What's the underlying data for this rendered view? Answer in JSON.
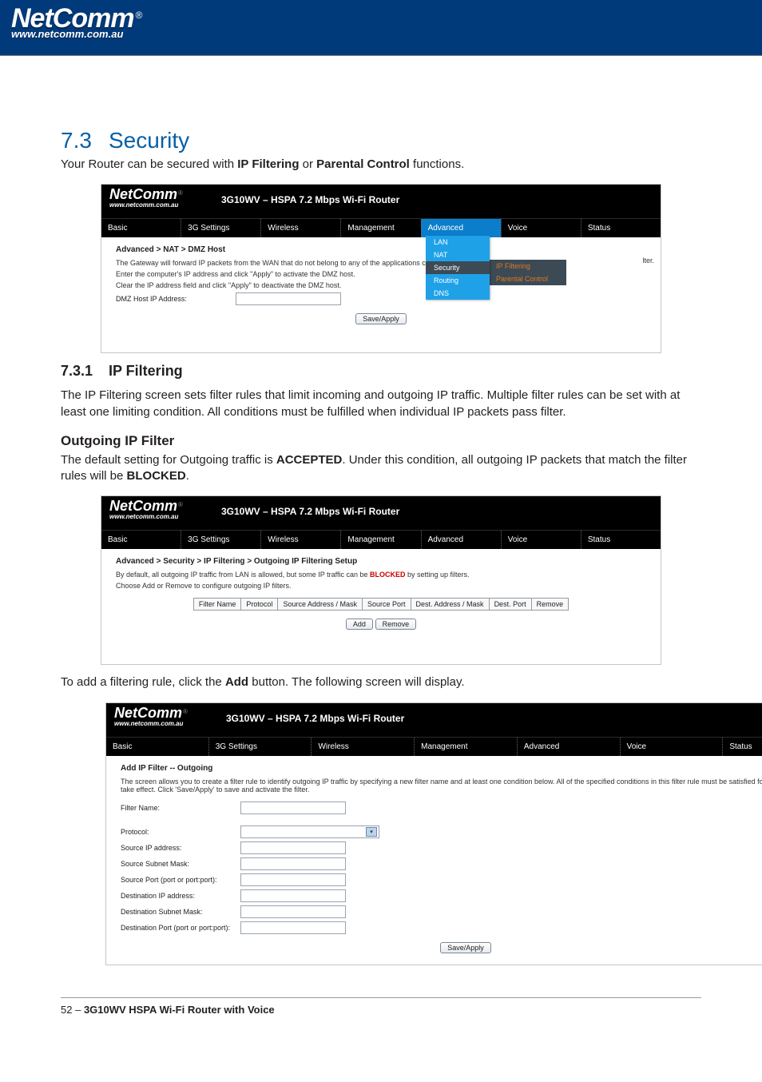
{
  "header": {
    "brand": "NetComm",
    "reg": "®",
    "url": "www.netcomm.com.au"
  },
  "section": {
    "number": "7.3",
    "title": "Security",
    "intro_plain_1": "Your Router can be secured with ",
    "intro_bold_1": "IP Filtering",
    "intro_plain_2": " or ",
    "intro_bold_2": "Parental Control",
    "intro_plain_3": " functions."
  },
  "shot1": {
    "brand": "NetComm",
    "reg": "®",
    "url": "www.netcomm.com.au",
    "title": "3G10WV – HSPA 7.2 Mbps Wi-Fi Router",
    "tabs": [
      "Basic",
      "3G Settings",
      "Wireless",
      "Management",
      "Advanced",
      "Voice",
      "Status"
    ],
    "breadcrumb": "Advanced > NAT > DMZ Host",
    "line1": "The Gateway will forward IP packets from the WAN that do not belong to any of the applications configur",
    "line_tail": "lter.",
    "line2": "Enter the computer's IP address and click \"Apply\" to activate the DMZ host.",
    "line3": "Clear the IP address field and click \"Apply\" to deactivate the DMZ host.",
    "label": "DMZ Host IP Address:",
    "button": "Save/Apply",
    "menu": [
      "LAN",
      "NAT",
      "Security",
      "Routing",
      "DNS"
    ],
    "submenu": [
      "IP Filtering",
      "Parental Control"
    ]
  },
  "subsection1": {
    "number": "7.3.1",
    "title": "IP Filtering",
    "para": "The IP Filtering screen sets filter rules that limit incoming and outgoing IP traffic. Multiple filter rules can be set with at least one limiting condition. All conditions must be fulfilled when individual IP packets pass filter."
  },
  "outgoing_head": "Outgoing IP Filter",
  "outgoing_para_1": "The default setting for Outgoing traffic is ",
  "outgoing_bold_1": "ACCEPTED",
  "outgoing_mid": ". Under this condition, all outgoing IP packets that match the filter rules will be ",
  "outgoing_bold_2": "BLOCKED",
  "outgoing_end": ".",
  "shot2": {
    "brand": "NetComm",
    "reg": "®",
    "url": "www.netcomm.com.au",
    "title": "3G10WV – HSPA 7.2 Mbps Wi-Fi Router",
    "tabs": [
      "Basic",
      "3G Settings",
      "Wireless",
      "Management",
      "Advanced",
      "Voice",
      "Status"
    ],
    "breadcrumb": "Advanced > Security > IP Filtering > Outgoing IP Filtering Setup",
    "line1a": "By default, all outgoing IP traffic from LAN is allowed, but some IP traffic can be ",
    "line1b": "BLOCKED",
    "line1c": " by setting up filters.",
    "line2": "Choose Add or Remove to configure outgoing IP filters.",
    "cols": [
      "Filter Name",
      "Protocol",
      "Source Address / Mask",
      "Source Port",
      "Dest. Address / Mask",
      "Dest. Port",
      "Remove"
    ],
    "btn_add": "Add",
    "btn_remove": "Remove"
  },
  "add_para_1": "To add a filtering rule, click the ",
  "add_bold": "Add",
  "add_para_2": " button. The following screen will display.",
  "shot3": {
    "brand": "NetComm",
    "reg": "®",
    "url": "www.netcomm.com.au",
    "title": "3G10WV – HSPA 7.2 Mbps Wi-Fi Router",
    "tabs": [
      "Basic",
      "3G Settings",
      "Wireless",
      "Management",
      "Advanced",
      "Voice",
      "Status"
    ],
    "breadcrumb": "Add IP Filter -- Outgoing",
    "desc": "The screen allows you to create a filter rule to identify outgoing IP traffic by specifying a new filter name and at least one condition below. All of the specified conditions in this filter rule must be satisfied for the rule to take effect. Click 'Save/Apply' to save and activate the filter.",
    "fields": {
      "filtername": "Filter Name:",
      "protocol": "Protocol:",
      "srcip": "Source IP address:",
      "srcmask": "Source Subnet Mask:",
      "srcport": "Source Port (port or port:port):",
      "dstip": "Destination IP address:",
      "dstmask": "Destination Subnet Mask:",
      "dstport": "Destination Port (port or port:port):"
    },
    "button": "Save/Apply"
  },
  "footer": {
    "page": "52",
    "sep": " – ",
    "product": "3G10WV HSPA Wi-Fi Router with Voice"
  }
}
